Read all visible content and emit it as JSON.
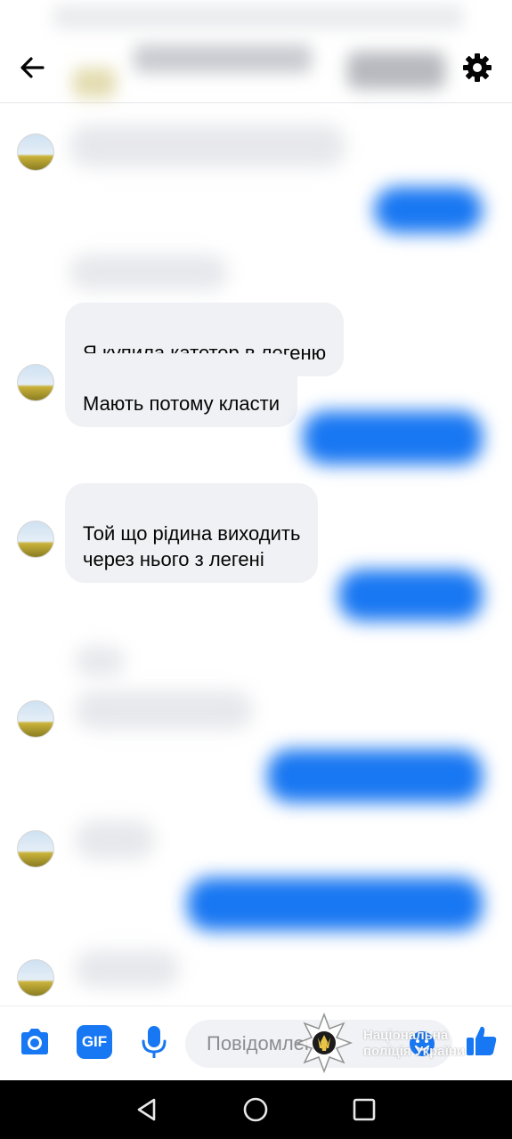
{
  "messages": {
    "m1": "Я купила катетор в легеню",
    "m2": "Мають потому класти",
    "m3": "Той що рідина виходить\nчерез нього з легені"
  },
  "composer": {
    "placeholder": "Повідомлення",
    "gif_label": "GIF"
  },
  "watermark": {
    "line1": "Національна",
    "line2": "поліція України"
  },
  "icons": {
    "header": [
      "back-arrow-icon",
      "gear-icon"
    ],
    "composer": [
      "camera-icon",
      "gif-icon",
      "microphone-icon",
      "emoji-icon",
      "thumbs-up-icon"
    ],
    "navigation": [
      "nav-back-icon",
      "nav-home-icon",
      "nav-recent-apps-icon"
    ]
  },
  "colors": {
    "accent": "#1877f2",
    "incoming_bubble": "#f0f1f4",
    "navbar": "#000000"
  }
}
